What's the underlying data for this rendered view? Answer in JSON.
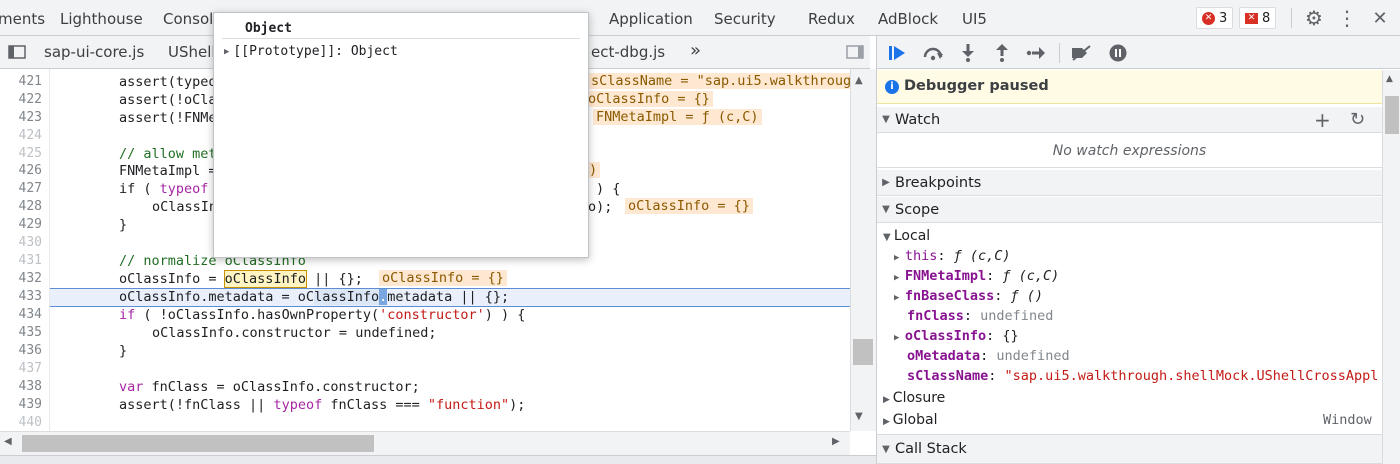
{
  "panel_tabs": [
    "ments",
    "Lighthouse",
    "Console",
    "Application",
    "Security",
    "Redux",
    "AdBlock",
    "UI5"
  ],
  "counts": {
    "errors": "3",
    "issues": "8"
  },
  "files": [
    "sap-ui-core.js",
    "UShellC",
    "ect-dbg.js"
  ],
  "overflow_glyph": "»",
  "code": {
    "line_numbers": [
      "421",
      "422",
      "423",
      "424",
      "425",
      "426",
      "427",
      "428",
      "429",
      "430",
      "431",
      "432",
      "433",
      "434",
      "435",
      "436",
      "437",
      "438",
      "439",
      "440"
    ],
    "lines": {
      "l421": "assert(typeo",
      "l422": "assert(!oCla",
      "l423": "assert(!FNMe",
      "l425": "// allow met",
      "l426": "FNMetaImpl =",
      "l427a": "if ( ",
      "l427b": "typeof",
      "l427c": ") {",
      "l428a": "oClassInf",
      "l428b": "o);",
      "l429": "}",
      "l431": "// normalize oClassInfo",
      "l432a": "oClassInfo = ",
      "l432b": "oClassInfo",
      "l432c": " || {};",
      "l433a": "oClassInfo.metadata = oC",
      "l433b": "lassInfo",
      "l433c": ".",
      "l433d": "metadata || {};",
      "l434a": "if ( !oClassInfo.hasOwnProperty(",
      "l434b": "'constructor'",
      "l434c": ") ) {",
      "l435": "oClassInfo.constructor = undefined;",
      "l436": "}",
      "l438a": "var",
      "l438b": " fnClass = oClassInfo.constructor;",
      "l439a": "assert(!fnClass || ",
      "l439b": "typeof",
      "l439c": " fnClass === ",
      "l439d": "\"function\"",
      "l439e": ");"
    },
    "inline_values": {
      "v421": "sClassName = \"sap.ui5.walkthroug",
      "v422": "oClassInfo = {}",
      "v423": "FNMetaImpl = ƒ (c,C)",
      "v426": ")",
      "v428": "oClassInfo = {}",
      "v432": "oClassInfo = {}"
    }
  },
  "popover": {
    "title": "Object",
    "row": "[[Prototype]]: Object"
  },
  "debugger": {
    "paused": "Debugger paused",
    "watch": "Watch",
    "no_watch": "No watch expressions",
    "breakpoints": "Breakpoints",
    "scope": "Scope",
    "local": "Local",
    "closure": "Closure",
    "global": "Global",
    "global_value": "Window",
    "call_stack": "Call Stack",
    "vars": [
      {
        "name": "this",
        "value": "ƒ (c,C)"
      },
      {
        "name": "FNMetaImpl",
        "value": "ƒ (c,C)"
      },
      {
        "name": "fnBaseClass",
        "value": "ƒ ()"
      },
      {
        "name": "fnClass",
        "value": "undefined"
      },
      {
        "name": "oClassInfo",
        "value": "{}"
      },
      {
        "name": "oMetadata",
        "value": "undefined"
      },
      {
        "name": "sClassName",
        "value": "\"sap.ui5.walkthrough.shellMock.UShellCrossAppl"
      }
    ]
  },
  "colors": {
    "accent": "#1a73e8",
    "error": "#d93025",
    "paused_bg": "#fffbe5"
  }
}
